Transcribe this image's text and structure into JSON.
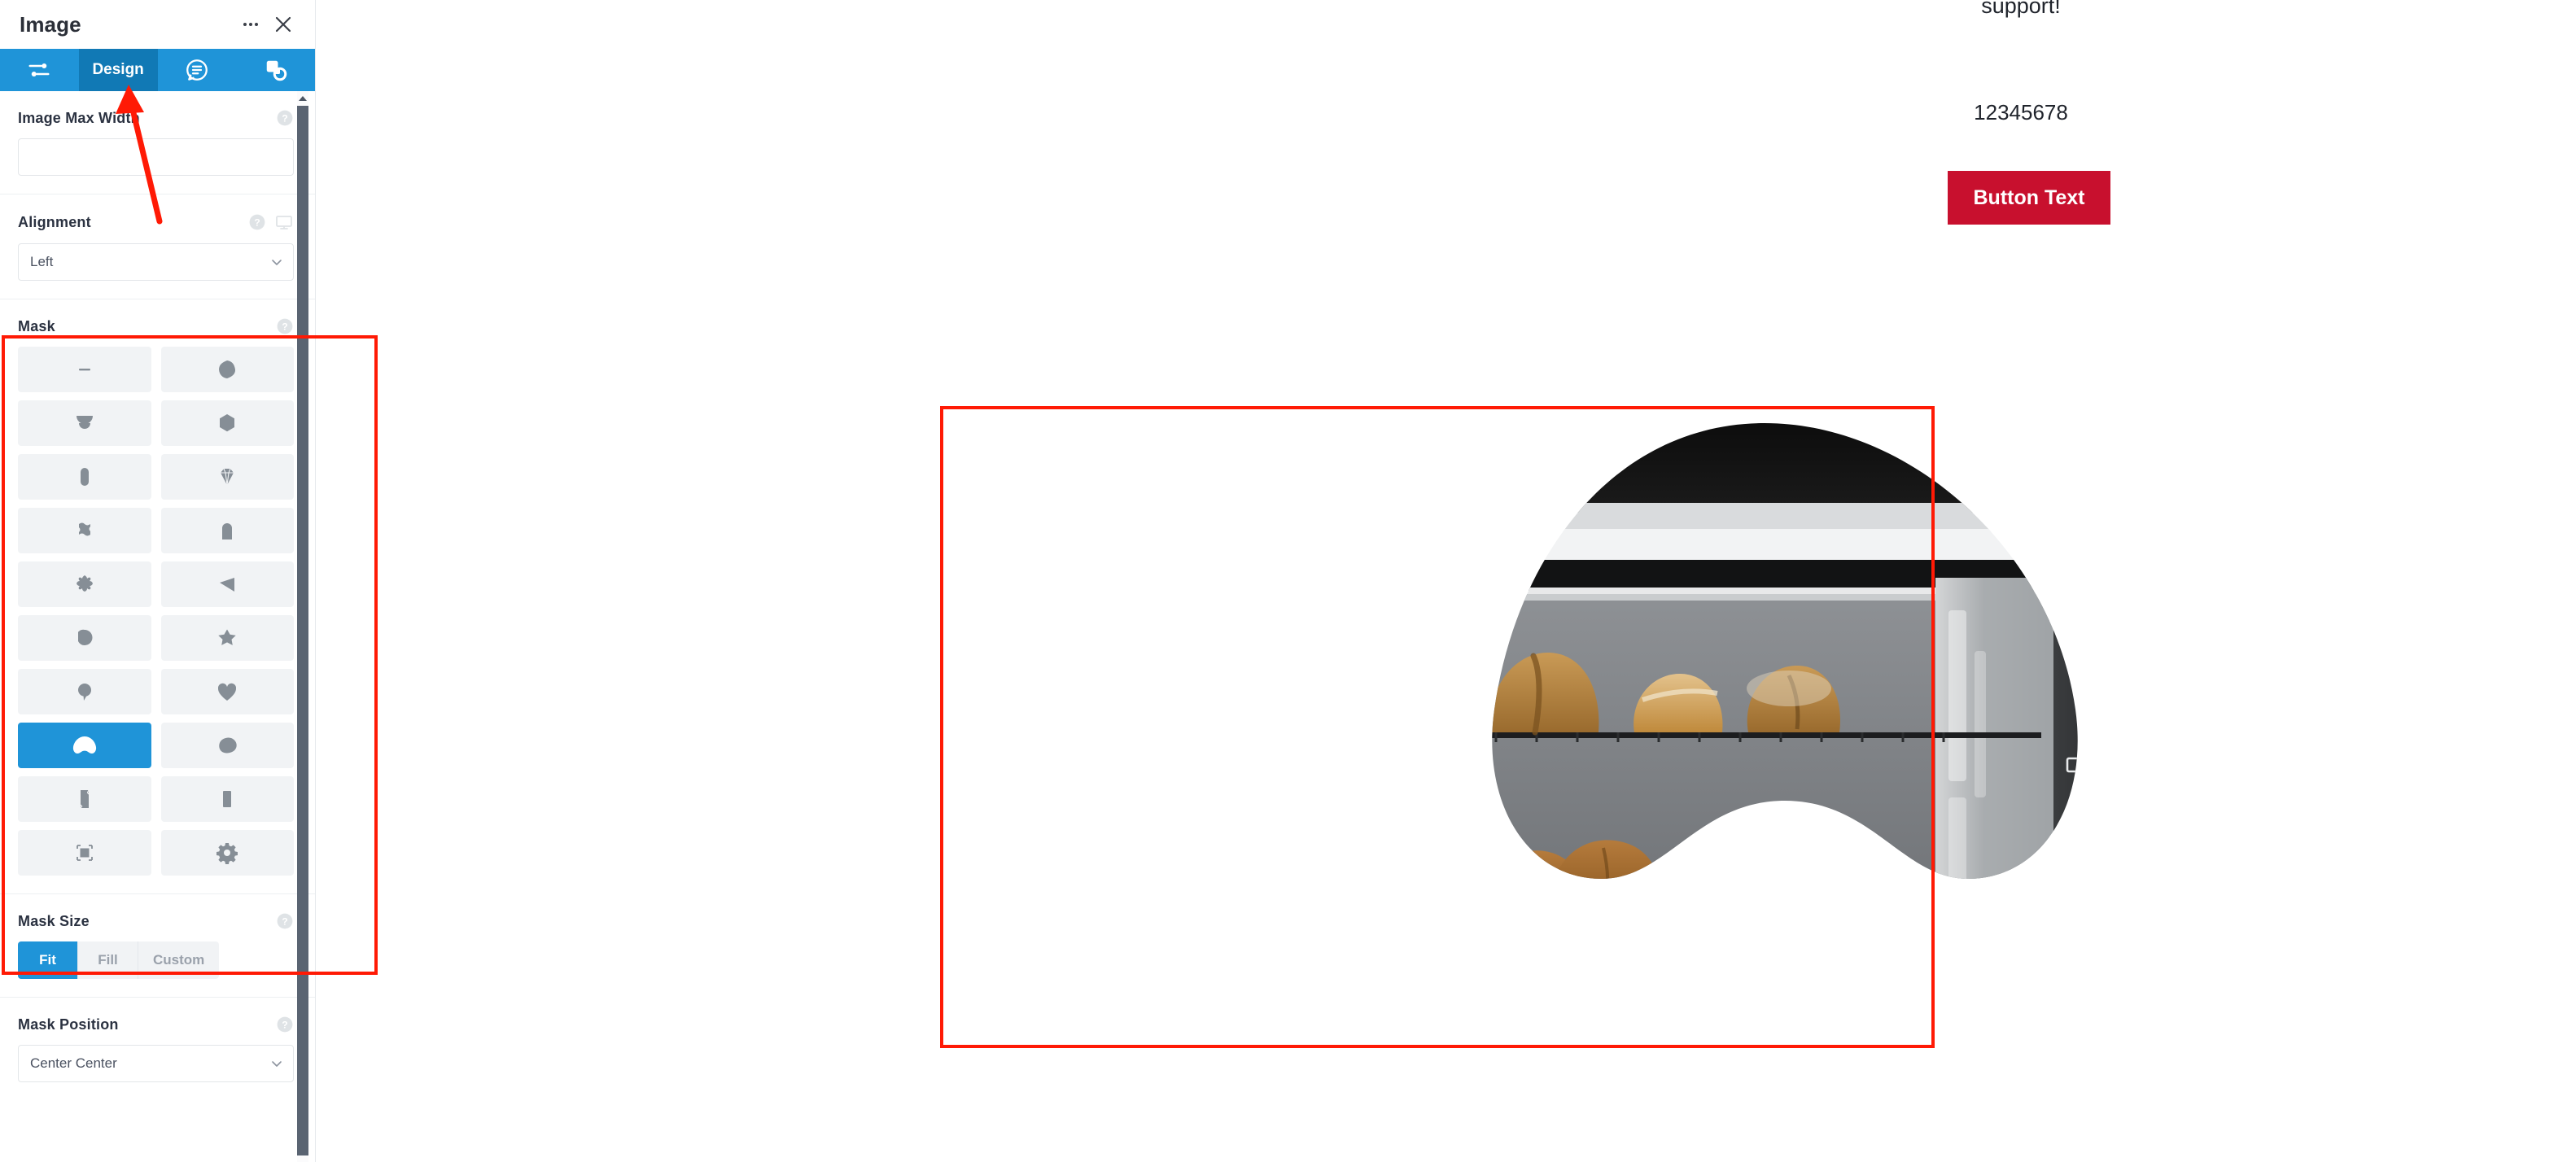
{
  "panel": {
    "title": "Image",
    "more_icon": "ellipsis-icon",
    "close_icon": "close-icon",
    "tabs": [
      {
        "id": "content",
        "label": "",
        "icon": "sliders-icon",
        "active": false
      },
      {
        "id": "design",
        "label": "Design",
        "icon": "",
        "active": true
      },
      {
        "id": "advanced",
        "label": "",
        "icon": "speech-bubble-lines-icon",
        "active": false
      },
      {
        "id": "layers",
        "label": "",
        "icon": "layers-icon",
        "active": false
      }
    ],
    "sections": {
      "image_max_width": {
        "label": "Image Max Width",
        "value": "",
        "placeholder": "",
        "help_icon": "question-mark-icon"
      },
      "alignment": {
        "label": "Alignment",
        "value": "Left",
        "help_icon": "question-mark-icon",
        "device_icon": "monitor-icon"
      },
      "mask": {
        "label": "Mask",
        "help_icon": "question-mark-icon",
        "selected_index": 16,
        "options": [
          {
            "index": 0,
            "name": "mask-none",
            "shape": "dash"
          },
          {
            "index": 1,
            "name": "mask-blob-round",
            "shape": "blob-round"
          },
          {
            "index": 2,
            "name": "mask-double-bowl",
            "shape": "double-bowl"
          },
          {
            "index": 3,
            "name": "mask-hexagon",
            "shape": "hexagon"
          },
          {
            "index": 4,
            "name": "mask-pill",
            "shape": "pill"
          },
          {
            "index": 5,
            "name": "mask-diamond",
            "shape": "diamond"
          },
          {
            "index": 6,
            "name": "mask-wavy-square",
            "shape": "wavy-square"
          },
          {
            "index": 7,
            "name": "mask-arch",
            "shape": "arch"
          },
          {
            "index": 8,
            "name": "mask-flower",
            "shape": "flower"
          },
          {
            "index": 9,
            "name": "mask-triangle",
            "shape": "triangle"
          },
          {
            "index": 10,
            "name": "mask-teardrop",
            "shape": "teardrop"
          },
          {
            "index": 11,
            "name": "mask-star",
            "shape": "star"
          },
          {
            "index": 12,
            "name": "mask-balloon",
            "shape": "balloon"
          },
          {
            "index": 13,
            "name": "mask-heart",
            "shape": "heart"
          },
          {
            "index": 14,
            "name": "mask-blob-leaf",
            "shape": "blob-leaf"
          },
          {
            "index": 15,
            "name": "mask-pebble",
            "shape": "pebble"
          },
          {
            "index": 16,
            "name": "mask-torn-paper",
            "shape": "torn-paper"
          },
          {
            "index": 17,
            "name": "mask-rectangle",
            "shape": "rectangle"
          },
          {
            "index": 18,
            "name": "mask-crop-frame",
            "shape": "crop-frame"
          },
          {
            "index": 19,
            "name": "mask-gear",
            "shape": "gear"
          }
        ]
      },
      "mask_size": {
        "label": "Mask Size",
        "help_icon": "question-mark-icon",
        "options": [
          "Fit",
          "Fill",
          "Custom"
        ],
        "selected": "Fit"
      },
      "mask_position": {
        "label": "Mask Position",
        "value": "Center Center",
        "help_icon": "question-mark-icon"
      }
    },
    "scrollbar": {
      "name": "panel-scrollbar"
    }
  },
  "canvas": {
    "support_text": "support!",
    "number_text": "12345678",
    "button_label": "Button Text",
    "button_color": "#c8102e",
    "image_alt": "oven-with-bread-and-croissants"
  },
  "annotations": {
    "accent_color": "#ff1a05",
    "mask_section_highlight": "mask-section-highlight",
    "canvas_image_highlight": "canvas-image-highlight",
    "arrow_to_design_tab": "arrow-pointing-to-design-tab"
  },
  "colors": {
    "tab_bar": "#1f94d8",
    "tab_active": "#1179b5",
    "accent_blue": "#1f94d8",
    "annotation_red": "#ff1a05",
    "button_red": "#c8102e",
    "mask_cell_bg": "#f1f3f5",
    "mask_icon": "#868e96"
  }
}
